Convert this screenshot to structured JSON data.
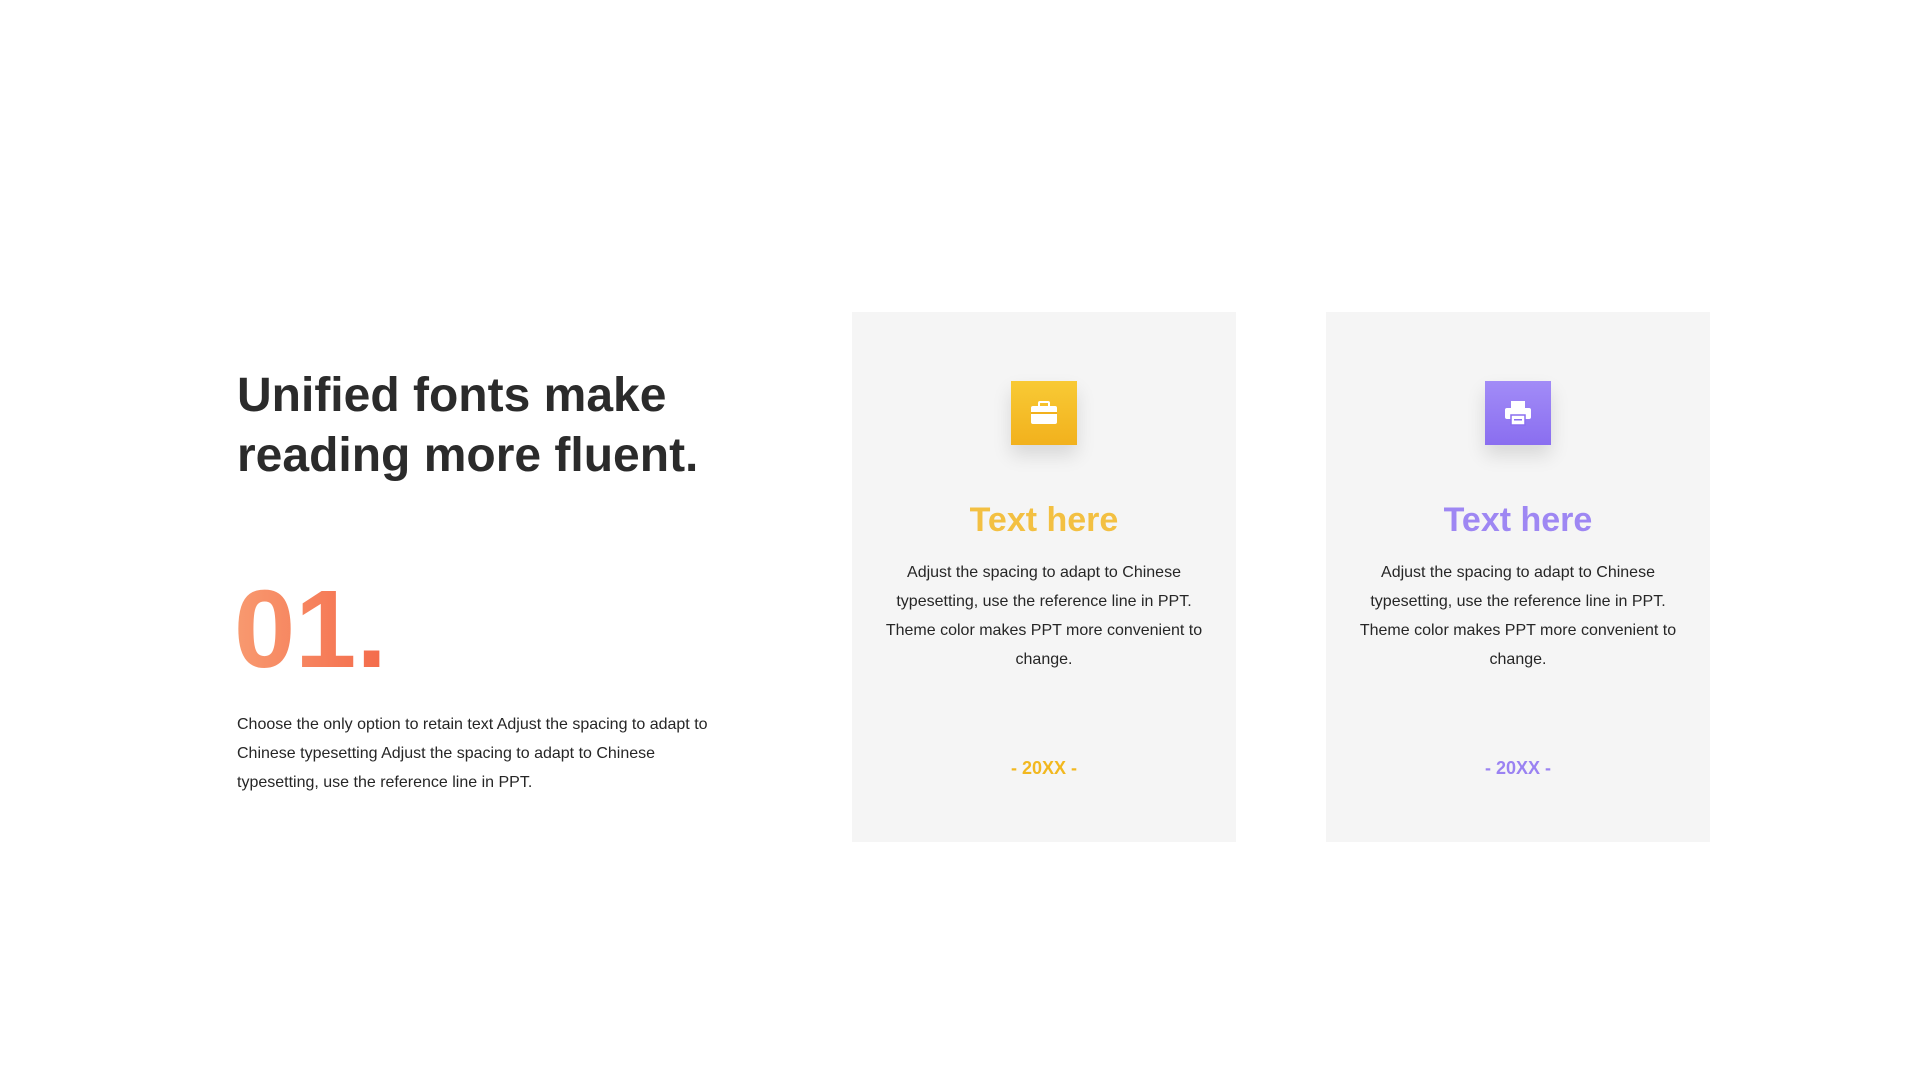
{
  "heading": "Unified fonts make reading more fluent.",
  "number": "01.",
  "lead_text": "Choose the only option to retain text Adjust the spacing to adapt to Chinese typesetting Adjust the spacing to adapt to Chinese typesetting, use the reference line in PPT.",
  "colors": {
    "number_gradient": [
      "#f89a70",
      "#f46a4a"
    ],
    "card_1_accent": "#f3c042",
    "card_2_accent": "#9e87f3"
  },
  "cards": [
    {
      "icon": "briefcase-icon",
      "title": "Text here",
      "body": "Adjust the spacing to adapt to Chinese typesetting, use the reference line in PPT. Theme color makes PPT more convenient to change.",
      "year": "- 20XX -"
    },
    {
      "icon": "printer-icon",
      "title": "Text here",
      "body": "Adjust the spacing to adapt to Chinese typesetting, use the reference line in PPT. Theme color makes PPT more convenient to change.",
      "year": "- 20XX -"
    }
  ]
}
